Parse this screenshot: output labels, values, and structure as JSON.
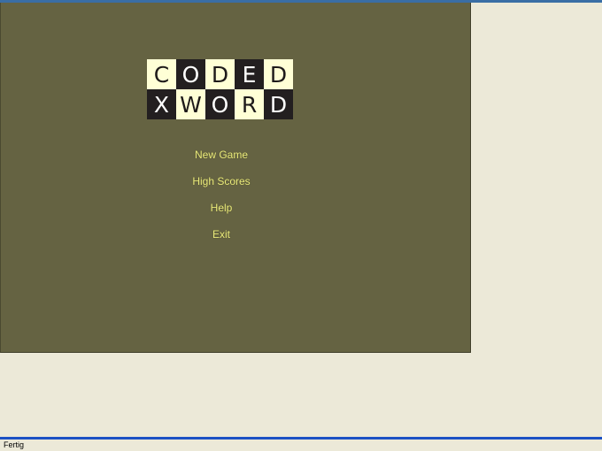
{
  "logo": {
    "rows": [
      [
        {
          "letter": "C",
          "style": "light"
        },
        {
          "letter": "O",
          "style": "dark"
        },
        {
          "letter": "D",
          "style": "light"
        },
        {
          "letter": "E",
          "style": "dark"
        },
        {
          "letter": "D",
          "style": "light"
        }
      ],
      [
        {
          "letter": "X",
          "style": "dark"
        },
        {
          "letter": "W",
          "style": "light"
        },
        {
          "letter": "O",
          "style": "dark"
        },
        {
          "letter": "R",
          "style": "light"
        },
        {
          "letter": "D",
          "style": "dark"
        }
      ]
    ]
  },
  "menu": {
    "new_game": "New Game",
    "high_scores": "High Scores",
    "help": "Help",
    "exit": "Exit"
  },
  "status_bar": {
    "text": "Fertig"
  },
  "colors": {
    "game_background": "#656342",
    "menu_text": "#EAEA7C",
    "tile_light": "#FFFFD6",
    "tile_dark": "#231F20",
    "window_background": "#ECE9D8"
  }
}
